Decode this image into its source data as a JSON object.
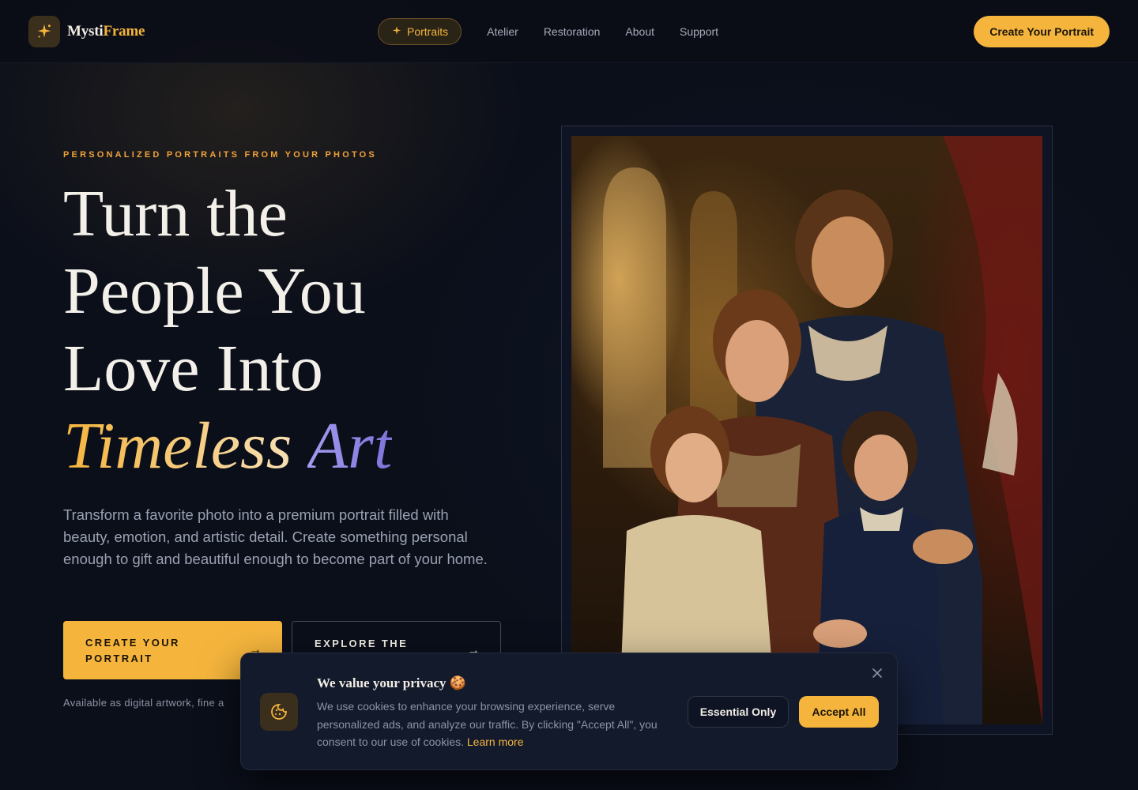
{
  "nav": {
    "logo_part1": "Mysti",
    "logo_part2": "Frame",
    "logo_icon": "sparkle-icon",
    "links": [
      {
        "label": "Portraits",
        "active": true
      },
      {
        "label": "Atelier"
      },
      {
        "label": "Restoration"
      },
      {
        "label": "About"
      },
      {
        "label": "Support"
      }
    ],
    "cta": "Create Your Portrait"
  },
  "hero": {
    "eyebrow": "PERSONALIZED PORTRAITS FROM YOUR PHOTOS",
    "headline_line1": "Turn the",
    "headline_line2": "People You",
    "headline_line3": "Love Into",
    "headline_accent1": "Timeless",
    "headline_accent2": "Art",
    "lede": "Transform a favorite photo into a premium portrait filled with beauty, emotion, and artistic detail. Create something personal enough to gift and beautiful enough to become part of your home.",
    "primary_button": "CREATE YOUR PORTRAIT",
    "secondary_button": "EXPLORE THE",
    "availability": "Available as digital artwork, fine a"
  },
  "cookie": {
    "title": "We value your privacy 🍪",
    "body": "We use cookies to enhance your browsing experience, serve personalized ads, and analyze our traffic. By clicking \"Accept All\", you consent to our use of cookies.",
    "link": "Learn more",
    "essential_button": "Essential Only",
    "accept_button": "Accept All",
    "icon": "cookie-icon"
  },
  "colors": {
    "background": "#0b0f1a",
    "accent": "#f5b53d",
    "violet": "#8f84e6"
  }
}
